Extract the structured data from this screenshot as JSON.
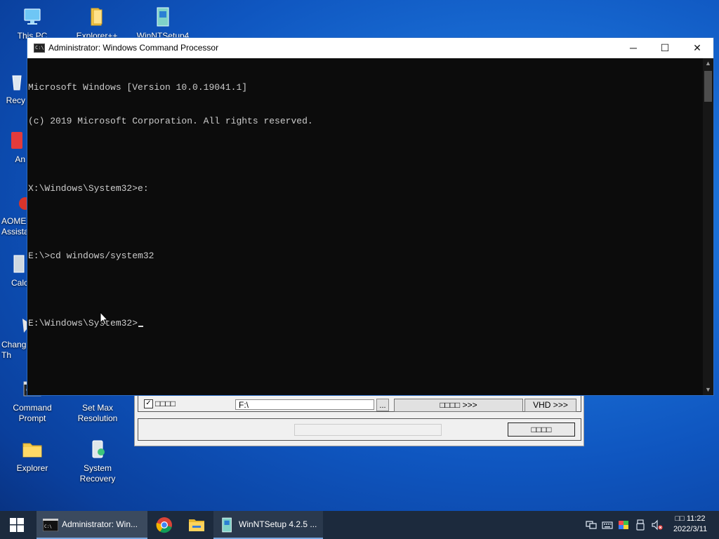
{
  "desktop": {
    "icons": [
      {
        "label": "This PC",
        "icon": "computer-icon"
      },
      {
        "label": "Explorer++",
        "icon": "folder-icon"
      },
      {
        "label": "WinNTSetup4",
        "icon": "winntsetup-icon"
      },
      {
        "label": "Recy",
        "icon": "recycle-bin-icon"
      },
      {
        "label": "An",
        "icon": "app-icon"
      },
      {
        "label": "AOME\nAssista",
        "icon": "aomei-icon"
      },
      {
        "label": "Calc",
        "icon": "calculator-icon"
      },
      {
        "label": "Chang\nTh",
        "icon": "theme-icon"
      },
      {
        "label": "Command\nPrompt",
        "icon": "cmd-icon"
      },
      {
        "label": "Set Max\nResolution",
        "icon": "monitor-icon"
      },
      {
        "label": "Explorer",
        "icon": "folder-icon"
      },
      {
        "label": "System Recovery",
        "icon": "recovery-icon"
      }
    ]
  },
  "winntsetup": {
    "checkbox_label": "□□□□",
    "checked": true,
    "path_value": "F:\\",
    "browse_label": "...",
    "options_button": "□□□□ >>>",
    "vhd_button": "VHD >>>",
    "start_button": "□□□□"
  },
  "cmd": {
    "title": "Administrator: Windows Command Processor",
    "icon_text": "C:\\",
    "lines": [
      "Microsoft Windows [Version 10.0.19041.1]",
      "(c) 2019 Microsoft Corporation. All rights reserved.",
      "",
      "X:\\Windows\\System32>e:",
      "",
      "E:\\>cd windows/system32",
      "",
      "E:\\Windows\\System32>"
    ],
    "minimize_glyph": "─",
    "maximize_glyph": "☐",
    "close_glyph": "✕"
  },
  "taskbar": {
    "items": [
      {
        "label": "Administrator: Win...",
        "icon": "cmd-icon",
        "active": true
      },
      {
        "label": "",
        "icon": "chrome-icon"
      },
      {
        "label": "",
        "icon": "file-explorer-icon"
      },
      {
        "label": "WinNTSetup 4.2.5   ...",
        "icon": "winntsetup-icon"
      }
    ],
    "tray_icons": [
      "network-icon",
      "keyboard-icon",
      "color-icon",
      "usb-icon",
      "volume-muted-icon"
    ],
    "time": "□□ 11:22",
    "date": "2022/3/11"
  },
  "colors": {
    "desktop_bg": "#1462c8",
    "console_bg": "#0c0c0c",
    "console_fg": "#cccccc",
    "taskbar_bg": "#1c2a3d",
    "accent": "#2b6cc4"
  }
}
